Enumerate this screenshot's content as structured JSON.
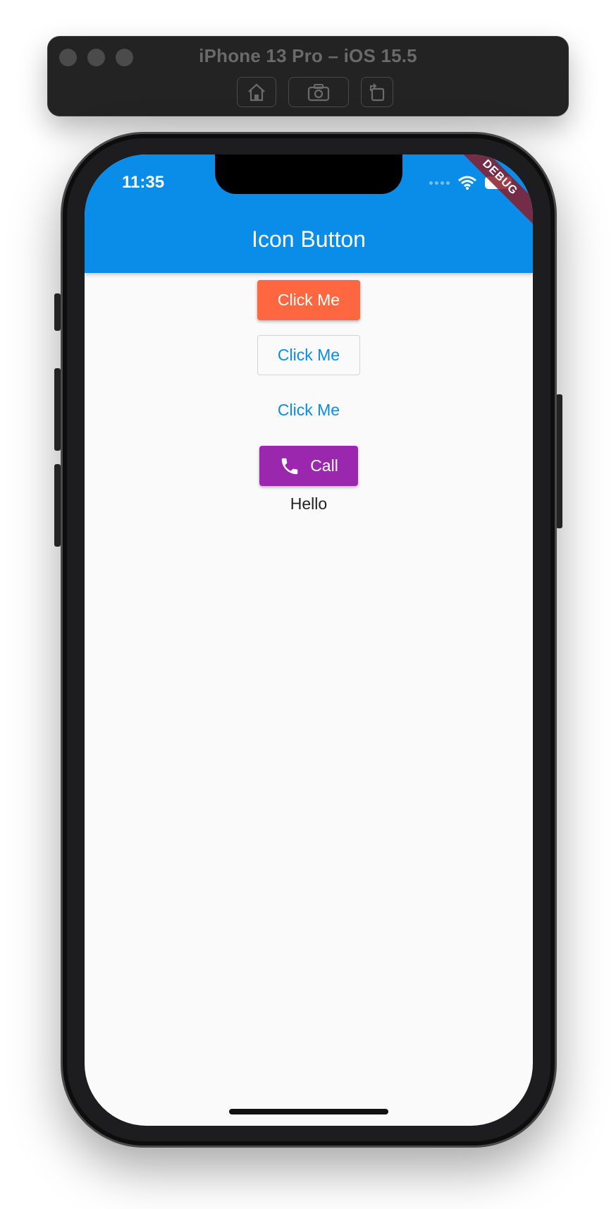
{
  "simulator": {
    "title": "iPhone 13 Pro – iOS 15.5",
    "toolbar": {
      "home_icon": "home-icon",
      "screenshot_icon": "camera-icon",
      "rotate_icon": "rotate-icon"
    }
  },
  "status_bar": {
    "time": "11:35"
  },
  "debug_banner": "DEBUG",
  "app_bar": {
    "title": "Icon Button",
    "color": "#0a8ce9"
  },
  "buttons": {
    "raised_label": "Click Me",
    "raised_color": "#ff6740",
    "outlined_label": "Click Me",
    "flat_label": "Click Me",
    "call_label": "Call",
    "call_icon": "phone-icon",
    "call_color": "#9b27af"
  },
  "hello_text": "Hello"
}
